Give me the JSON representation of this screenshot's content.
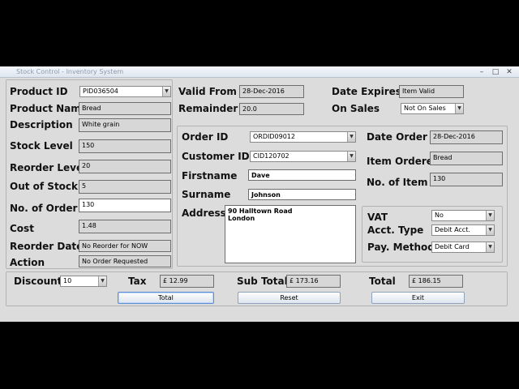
{
  "window": {
    "title": "Stock Control - Inventory System",
    "min": "–",
    "max": "□",
    "close": "✕"
  },
  "product": {
    "product_id_label": "Product ID",
    "product_id": "PID036504",
    "product_name_label": "Product Name",
    "product_name": "Bread",
    "description_label": "Description",
    "description": "White grain",
    "stock_level_label": "Stock Level",
    "stock_level": "150",
    "reorder_level_label": "Reorder Level",
    "reorder_level": "20",
    "out_of_stock_label": "Out of Stock",
    "out_of_stock": "5",
    "no_of_order_label": "No. of Order",
    "no_of_order": "130",
    "cost_label": "Cost",
    "cost": "1.48",
    "reorder_date_label": "Reorder Date",
    "reorder_date": "No Reorder for NOW",
    "action_label": "Action",
    "action": "No Order Requested"
  },
  "validity": {
    "valid_from_label": "Valid From",
    "valid_from": "28-Dec-2016",
    "remainder_label": "Remainder",
    "remainder": "20.0",
    "date_expires_label": "Date Expires",
    "date_expires": "Item Valid",
    "on_sales_label": "On Sales",
    "on_sales": "Not On Sales"
  },
  "order": {
    "order_id_label": "Order ID",
    "order_id": "ORDID09012",
    "customer_id_label": "Customer ID",
    "customer_id": "CID120702",
    "firstname_label": "Firstname",
    "firstname": "Dave",
    "surname_label": "Surname",
    "surname": "Johnson",
    "address_label": "Address",
    "address_line1": "90 Halltown Road",
    "address_line2": "London",
    "date_order_label": "Date Order",
    "date_order": "28-Dec-2016",
    "item_ordered_label": "Item Ordered",
    "item_ordered": "Bread",
    "no_of_item_label": "No. of Item",
    "no_of_item": "130"
  },
  "payment": {
    "vat_label": "VAT",
    "vat": "No",
    "acct_type_label": "Acct. Type",
    "acct_type": "Debit Acct.",
    "pay_method_label": "Pay. Method",
    "pay_method": "Debit Card"
  },
  "totals": {
    "discount_label": "Discount",
    "discount": "10",
    "tax_label": "Tax",
    "tax": "£ 12.99",
    "subtotal_label": "Sub Total",
    "subtotal": "£ 173.16",
    "total_label": "Total",
    "total": "£ 186.15"
  },
  "buttons": {
    "total": "Total",
    "reset": "Reset",
    "exit": "Exit"
  }
}
